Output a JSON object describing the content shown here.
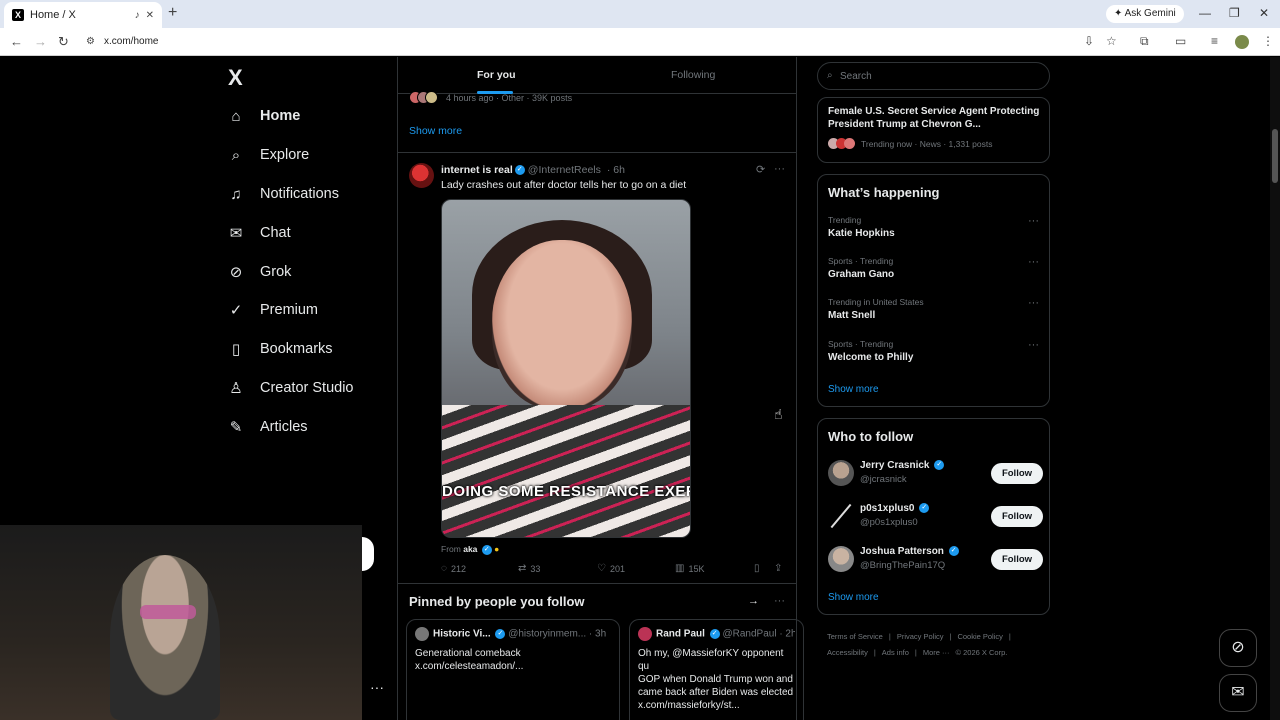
{
  "browser": {
    "tab_title": "Home / X",
    "tab_favicon": "X",
    "new_tab_icon": "+",
    "gemini_label": "Ask Gemini",
    "url": "x.com/home"
  },
  "sidebar": {
    "logo": "X",
    "items": [
      {
        "label": "Home",
        "icon": "⌂"
      },
      {
        "label": "Explore",
        "icon": "⌕"
      },
      {
        "label": "Notifications",
        "icon": "♫"
      },
      {
        "label": "Chat",
        "icon": "✉"
      },
      {
        "label": "Grok",
        "icon": "⊘"
      },
      {
        "label": "Premium",
        "icon": "✓"
      },
      {
        "label": "Bookmarks",
        "icon": "▯"
      },
      {
        "label": "Creator Studio",
        "icon": "♙"
      },
      {
        "label": "Articles",
        "icon": "✎"
      }
    ],
    "more_label": "···"
  },
  "feed": {
    "tabs": [
      "For you",
      "Following"
    ],
    "prev_meta": "4 hours ago · Other · 39K posts",
    "show_more": "Show more",
    "post": {
      "name": "internet is real",
      "handle": "@InternetReels",
      "time": "· 6h",
      "text": "Lady crashes out after doctor tells her to go on a diet",
      "caption": "DOING SOME RESISTANCE EXERC",
      "from_prefix": "From",
      "from_name": "aka",
      "replies": "212",
      "reposts": "33",
      "likes": "201",
      "views": "15K"
    },
    "pinned": {
      "title": "Pinned by people you follow",
      "cards": [
        {
          "name": "Historic Vi...",
          "handle": "@historyinmem...",
          "time": "· 3h",
          "text": "Generational comeback\nx.com/celesteamadon/..."
        },
        {
          "name": "Rand Paul",
          "handle": "@RandPaul",
          "time": "· 2h",
          "text": "Oh my, @MassieforKY opponent qu\nGOP when  Donald Trump won and\ncame back after Biden was elected\nx.com/massieforky/st..."
        }
      ]
    }
  },
  "right": {
    "search_placeholder": "Search",
    "top_trend": {
      "title": "Female U.S. Secret Service Agent Protecting President Trump at Chevron G...",
      "meta": "Trending now · News · 1,331 posts"
    },
    "whats_happening": {
      "title": "What’s happening",
      "trends": [
        {
          "meta": "Trending",
          "name": "Katie Hopkins"
        },
        {
          "meta": "Sports · Trending",
          "name": "Graham Gano"
        },
        {
          "meta": "Trending in United States",
          "name": "Matt Snell"
        },
        {
          "meta": "Sports · Trending",
          "name": "Welcome to Philly"
        }
      ],
      "show_more": "Show more"
    },
    "who_to_follow": {
      "title": "Who to follow",
      "users": [
        {
          "name": "Jerry Crasnick",
          "handle": "@jcrasnick",
          "button": "Follow"
        },
        {
          "name": "p0s1xplus0",
          "handle": "@p0s1xplus0",
          "button": "Follow"
        },
        {
          "name": "Joshua Patterson",
          "handle": "@BringThePain17Q",
          "button": "Follow"
        }
      ],
      "show_more": "Show more"
    },
    "footer": [
      "Terms of Service",
      "|",
      "Privacy Policy",
      "|",
      "Cookie Policy",
      "|",
      "Accessibility",
      "|",
      "Ads info",
      "|",
      "More ···",
      "© 2026 X Corp."
    ]
  },
  "colors": {
    "accent": "#1d9bf0",
    "background": "#000000",
    "text": "#e7e9ea",
    "muted": "#71767b",
    "border": "#2f3336"
  }
}
